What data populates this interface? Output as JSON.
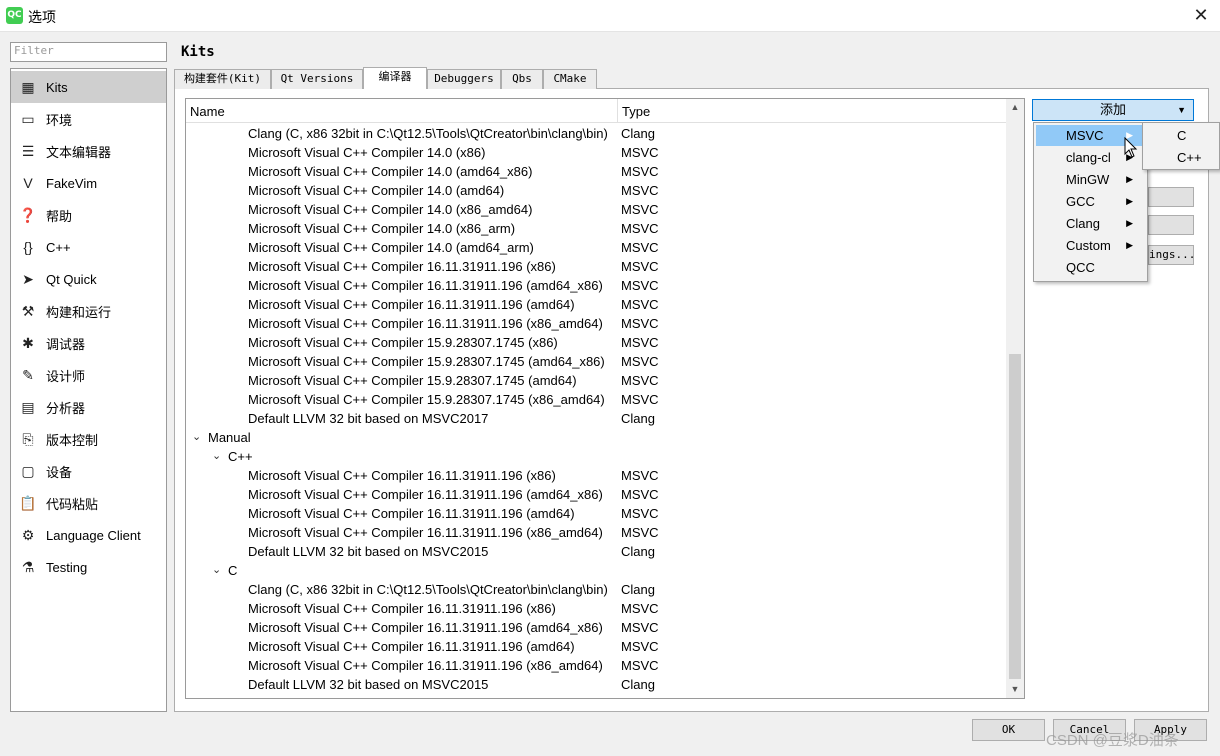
{
  "window": {
    "title": "选项",
    "app_badge": "QC"
  },
  "filter": {
    "placeholder": "Filter"
  },
  "sidebar": {
    "items": [
      {
        "label": "Kits",
        "icon": "kits-icon",
        "glyph": "▦",
        "selected": true
      },
      {
        "label": "环境",
        "icon": "monitor-icon",
        "glyph": "▭"
      },
      {
        "label": "文本编辑器",
        "icon": "document-icon",
        "glyph": "☰"
      },
      {
        "label": "FakeVim",
        "icon": "fakevim-icon",
        "glyph": "V"
      },
      {
        "label": "帮助",
        "icon": "help-icon",
        "glyph": "❓"
      },
      {
        "label": "C++",
        "icon": "braces-icon",
        "glyph": "{}"
      },
      {
        "label": "Qt Quick",
        "icon": "paper-plane-icon",
        "glyph": "➤"
      },
      {
        "label": "构建和运行",
        "icon": "hammer-icon",
        "glyph": "⚒"
      },
      {
        "label": "调试器",
        "icon": "bug-icon",
        "glyph": "✱"
      },
      {
        "label": "设计师",
        "icon": "pencil-icon",
        "glyph": "✎"
      },
      {
        "label": "分析器",
        "icon": "analyzer-icon",
        "glyph": "▤"
      },
      {
        "label": "版本控制",
        "icon": "version-control-icon",
        "glyph": "⎘"
      },
      {
        "label": "设备",
        "icon": "device-icon",
        "glyph": "▢"
      },
      {
        "label": "代码粘贴",
        "icon": "paste-icon",
        "glyph": "📋"
      },
      {
        "label": "Language Client",
        "icon": "language-client-icon",
        "glyph": "⚙"
      },
      {
        "label": "Testing",
        "icon": "flask-icon",
        "glyph": "⚗"
      }
    ]
  },
  "page": {
    "title": "Kits"
  },
  "tabs": [
    {
      "label": "构建套件(Kit)"
    },
    {
      "label": "Qt Versions"
    },
    {
      "label": "编译器",
      "active": true
    },
    {
      "label": "Debuggers"
    },
    {
      "label": "Qbs"
    },
    {
      "label": "CMake"
    }
  ],
  "tree": {
    "headers": {
      "name": "Name",
      "type": "Type"
    },
    "rows": [
      {
        "name": "Clang (C, x86 32bit in C:\\Qt12.5\\Tools\\QtCreator\\bin\\clang\\bin)",
        "type": "Clang",
        "level": 2
      },
      {
        "name": "Microsoft Visual C++ Compiler 14.0 (x86)",
        "type": "MSVC",
        "level": 2
      },
      {
        "name": "Microsoft Visual C++ Compiler 14.0 (amd64_x86)",
        "type": "MSVC",
        "level": 2
      },
      {
        "name": "Microsoft Visual C++ Compiler 14.0 (amd64)",
        "type": "MSVC",
        "level": 2
      },
      {
        "name": "Microsoft Visual C++ Compiler 14.0 (x86_amd64)",
        "type": "MSVC",
        "level": 2
      },
      {
        "name": "Microsoft Visual C++ Compiler 14.0 (x86_arm)",
        "type": "MSVC",
        "level": 2
      },
      {
        "name": "Microsoft Visual C++ Compiler 14.0 (amd64_arm)",
        "type": "MSVC",
        "level": 2
      },
      {
        "name": "Microsoft Visual C++ Compiler 16.11.31911.196 (x86)",
        "type": "MSVC",
        "level": 2
      },
      {
        "name": "Microsoft Visual C++ Compiler 16.11.31911.196 (amd64_x86)",
        "type": "MSVC",
        "level": 2
      },
      {
        "name": "Microsoft Visual C++ Compiler 16.11.31911.196 (amd64)",
        "type": "MSVC",
        "level": 2
      },
      {
        "name": "Microsoft Visual C++ Compiler 16.11.31911.196 (x86_amd64)",
        "type": "MSVC",
        "level": 2
      },
      {
        "name": "Microsoft Visual C++ Compiler 15.9.28307.1745 (x86)",
        "type": "MSVC",
        "level": 2
      },
      {
        "name": "Microsoft Visual C++ Compiler 15.9.28307.1745 (amd64_x86)",
        "type": "MSVC",
        "level": 2
      },
      {
        "name": "Microsoft Visual C++ Compiler 15.9.28307.1745 (amd64)",
        "type": "MSVC",
        "level": 2
      },
      {
        "name": "Microsoft Visual C++ Compiler 15.9.28307.1745 (x86_amd64)",
        "type": "MSVC",
        "level": 2
      },
      {
        "name": "Default LLVM 32 bit based on MSVC2017",
        "type": "Clang",
        "level": 2
      },
      {
        "name": "Manual",
        "type": "",
        "level": 0,
        "expander": true
      },
      {
        "name": "C++",
        "type": "",
        "level": 1,
        "expander": true
      },
      {
        "name": "Microsoft Visual C++ Compiler 16.11.31911.196 (x86)",
        "type": "MSVC",
        "level": 2
      },
      {
        "name": "Microsoft Visual C++ Compiler 16.11.31911.196 (amd64_x86)",
        "type": "MSVC",
        "level": 2
      },
      {
        "name": "Microsoft Visual C++ Compiler 16.11.31911.196 (amd64)",
        "type": "MSVC",
        "level": 2
      },
      {
        "name": "Microsoft Visual C++ Compiler 16.11.31911.196 (x86_amd64)",
        "type": "MSVC",
        "level": 2
      },
      {
        "name": "Default LLVM 32 bit based on MSVC2015",
        "type": "Clang",
        "level": 2
      },
      {
        "name": "C",
        "type": "",
        "level": 1,
        "expander": true
      },
      {
        "name": "Clang (C, x86 32bit in C:\\Qt12.5\\Tools\\QtCreator\\bin\\clang\\bin)",
        "type": "Clang",
        "level": 2
      },
      {
        "name": "Microsoft Visual C++ Compiler 16.11.31911.196 (x86)",
        "type": "MSVC",
        "level": 2
      },
      {
        "name": "Microsoft Visual C++ Compiler 16.11.31911.196 (amd64_x86)",
        "type": "MSVC",
        "level": 2
      },
      {
        "name": "Microsoft Visual C++ Compiler 16.11.31911.196 (amd64)",
        "type": "MSVC",
        "level": 2
      },
      {
        "name": "Microsoft Visual C++ Compiler 16.11.31911.196 (x86_amd64)",
        "type": "MSVC",
        "level": 2
      },
      {
        "name": "Default LLVM 32 bit based on MSVC2015",
        "type": "Clang",
        "level": 2
      }
    ]
  },
  "add_button": {
    "label": "添加"
  },
  "side_button": {
    "label": "ings..."
  },
  "add_menu": {
    "items": [
      {
        "label": "MSVC",
        "highlighted": true,
        "submenu": true
      },
      {
        "label": "clang-cl",
        "submenu": true
      },
      {
        "label": "MinGW",
        "submenu": true
      },
      {
        "label": "GCC",
        "submenu": true
      },
      {
        "label": "Clang",
        "submenu": true
      },
      {
        "label": "Custom",
        "submenu": true
      },
      {
        "label": "QCC",
        "submenu": false
      }
    ]
  },
  "submenu": {
    "items": [
      {
        "label": "C"
      },
      {
        "label": "C++"
      }
    ]
  },
  "dialog_buttons": {
    "ok": "OK",
    "cancel": "Cancel",
    "apply": "Apply"
  },
  "watermark": "CSDN @豆浆D油条",
  "colors": {
    "menu_highlight": "#91c9f7",
    "add_button_bg": "#cce4f7",
    "add_button_border": "#0078d7",
    "selection": "#cfcfcf"
  }
}
